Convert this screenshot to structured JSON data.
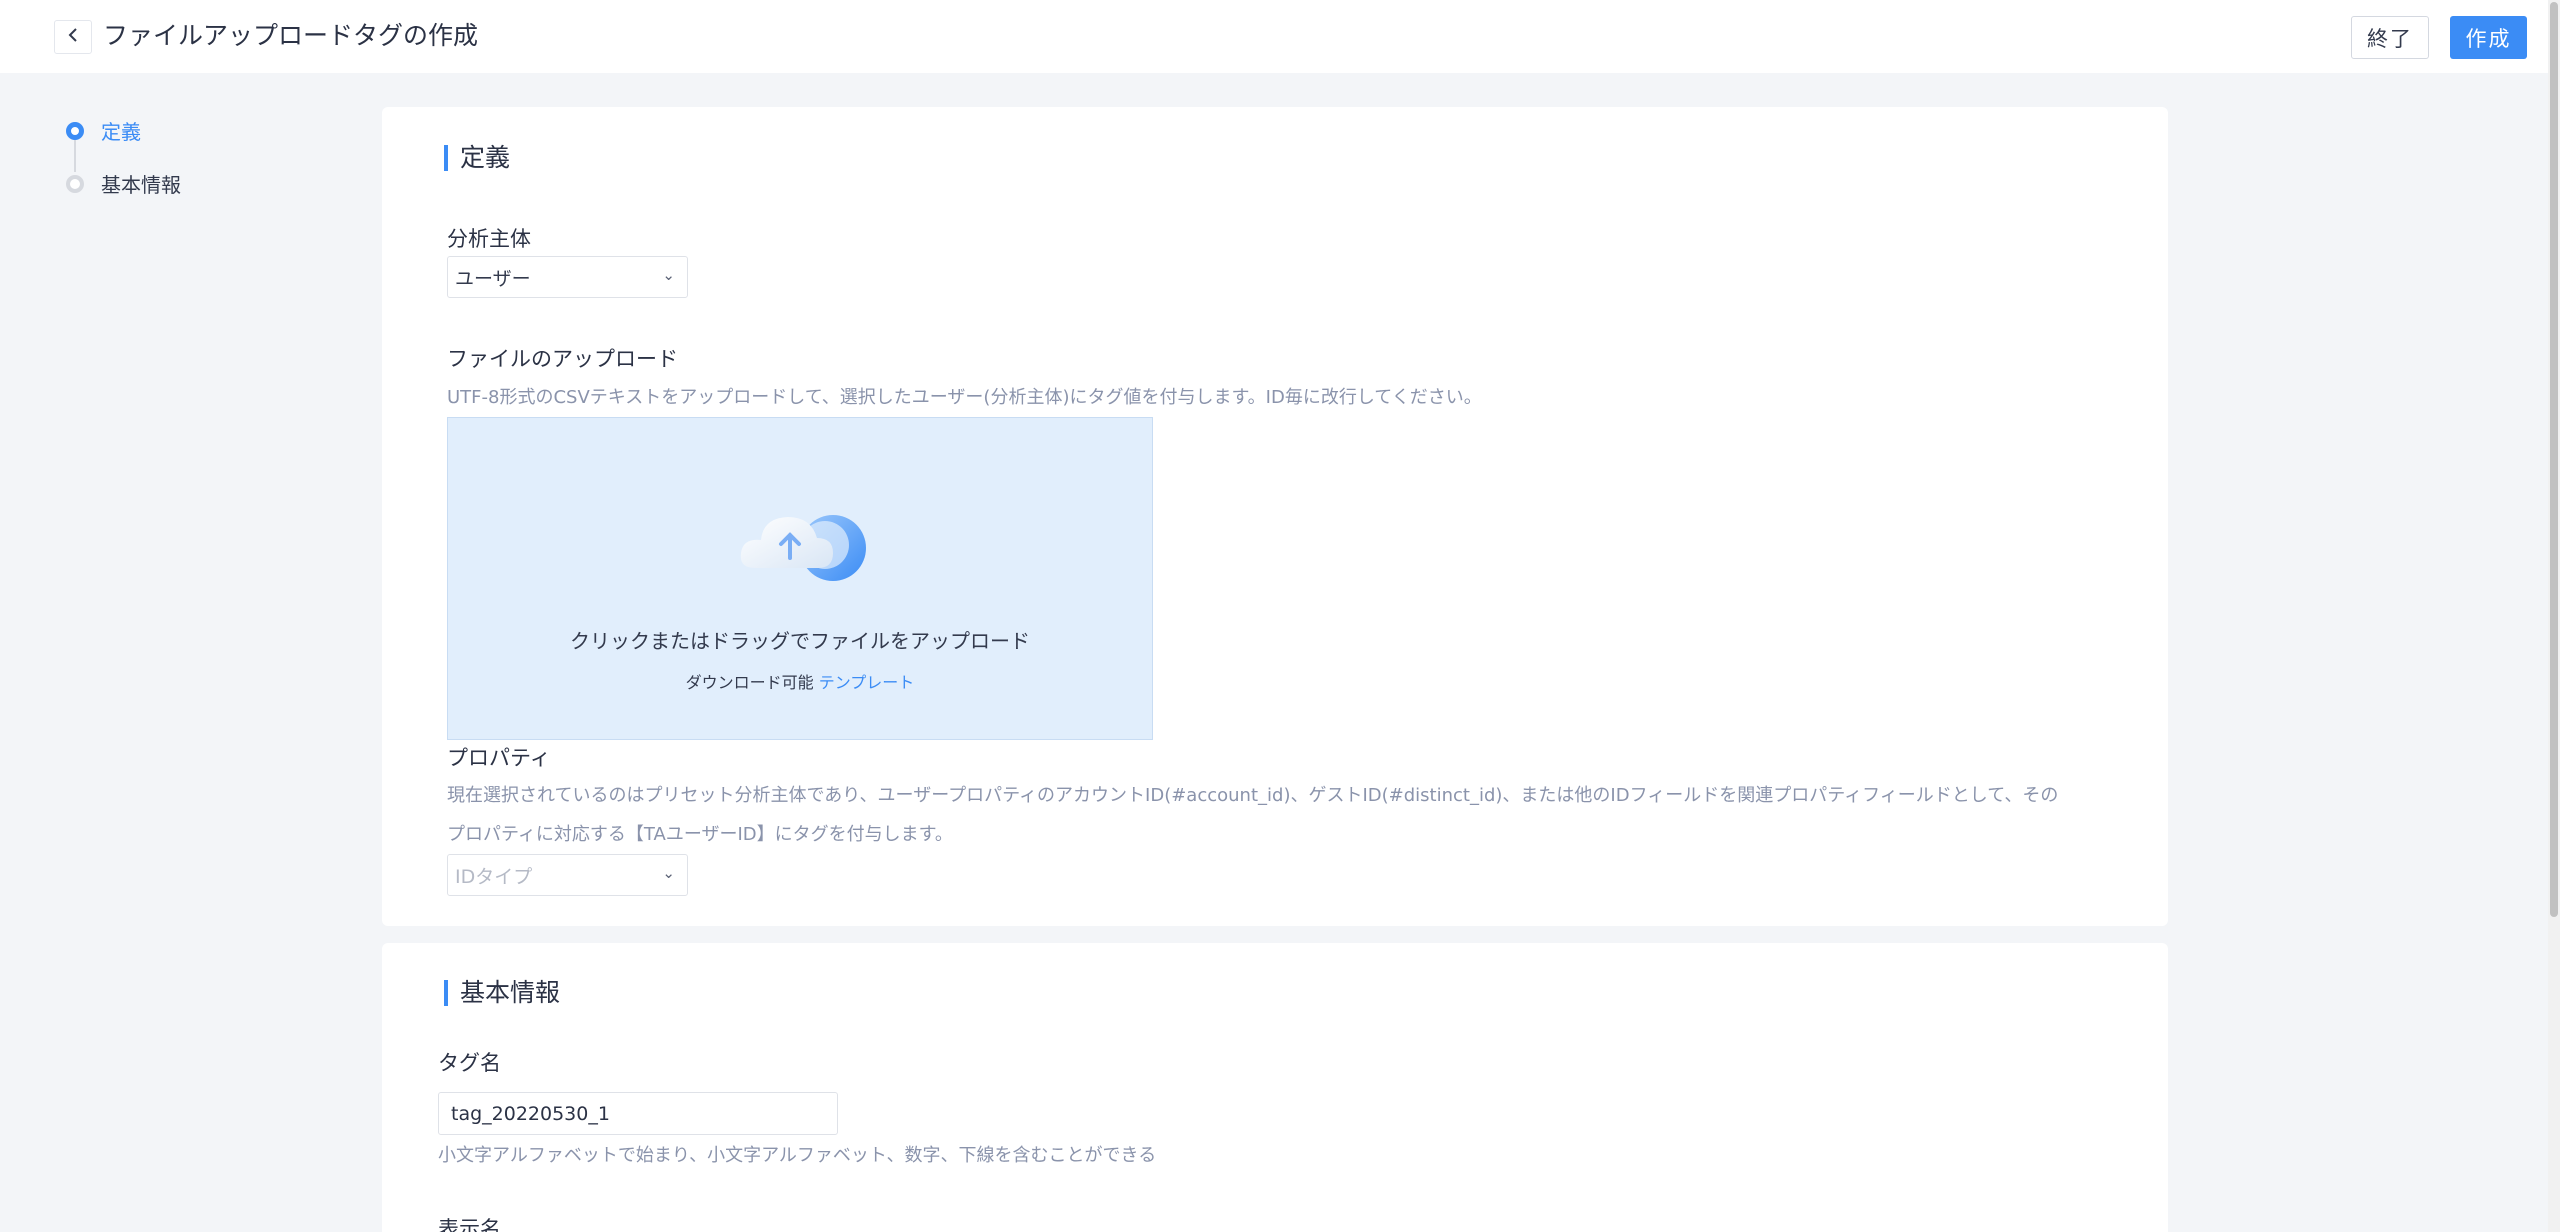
{
  "header": {
    "title": "ファイルアップロードタグの作成",
    "exit_label": "終了",
    "create_label": "作成"
  },
  "steps": [
    {
      "label": "定義",
      "active": true
    },
    {
      "label": "基本情報",
      "active": false
    }
  ],
  "definition": {
    "title": "定義",
    "subject_label": "分析主体",
    "subject_value": "ユーザー",
    "upload_label": "ファイルのアップロード",
    "upload_hint": "UTF-8形式のCSVテキストをアップロードして、選択したユーザー(分析主体)にタグ値を付与します。ID毎に改行してください。",
    "upload_main_text": "クリックまたはドラッグでファイルをアップロード",
    "upload_sub_text": "ダウンロード可能",
    "upload_template_link": "テンプレート",
    "property_label": "プロパティ",
    "property_hint_line1": "現在選択されているのはプリセット分析主体であり、ユーザープロパティのアカウントID(#account_id)、ゲストID(#distinct_id)、または他のIDフィールドを関連プロパティフィールドとして、その",
    "property_hint_line2": "プロパティに対応する【TAユーザーID】にタグを付与します。",
    "property_select_placeholder": "IDタイプ"
  },
  "basic_info": {
    "title": "基本情報",
    "tag_name_label": "タグ名",
    "tag_name_value": "tag_20220530_1",
    "tag_name_hint": "小文字アルファベットで始まり、小文字アルファベット、数字、下線を含むことができる",
    "display_name_label": "表示名"
  },
  "colors": {
    "accent": "#3b8cf5",
    "background": "#f3f5f8",
    "upload_area": "#e1eefc"
  }
}
